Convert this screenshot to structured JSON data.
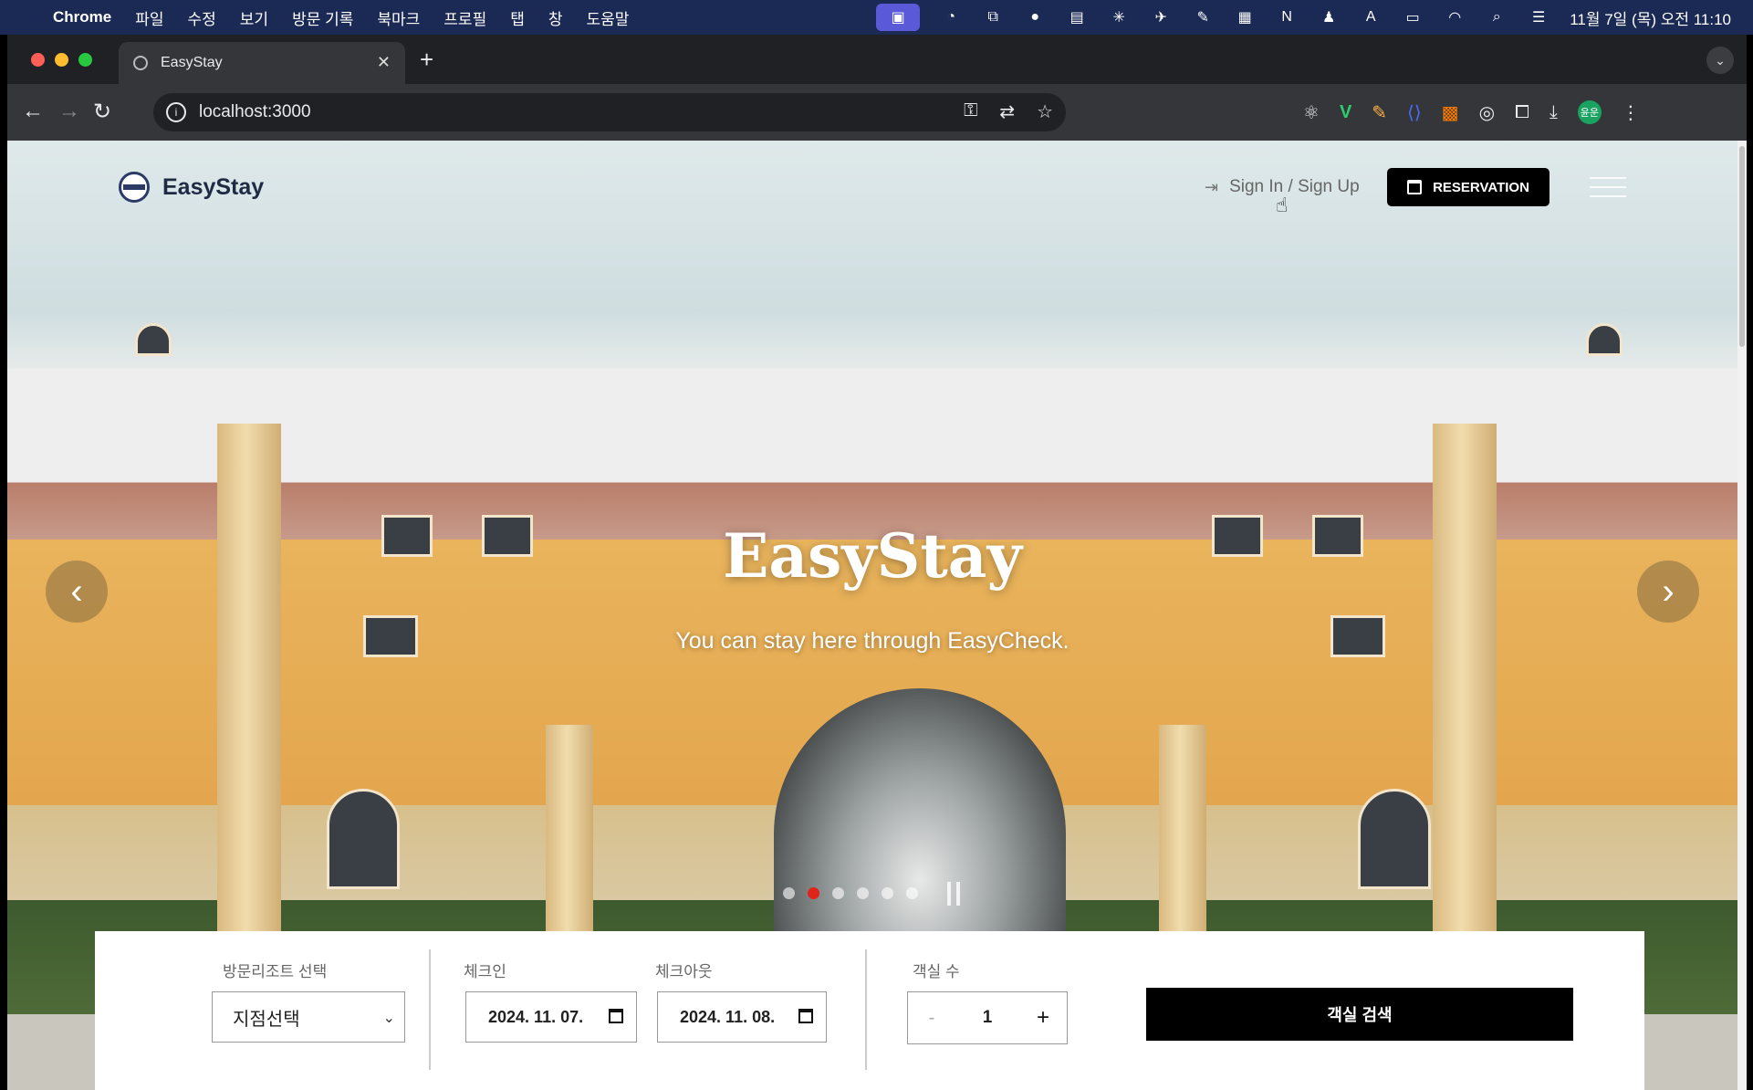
{
  "menubar": {
    "app": "Chrome",
    "items": [
      "파일",
      "수정",
      "보기",
      "방문 기록",
      "북마크",
      "프로필",
      "탭",
      "창",
      "도움말"
    ],
    "clock": "11월 7일 (목) 오전 11:10"
  },
  "browser": {
    "tab_title": "EasyStay",
    "url": "localhost:3000",
    "profile_initials": "윤운"
  },
  "site": {
    "logo_text": "EasyStay",
    "signin_label": "Sign In / Sign Up",
    "reservation_label": "RESERVATION"
  },
  "hero": {
    "title": "EasyStay",
    "subtitle": "You can stay here through EasyCheck.",
    "slide_count": 6,
    "active_slide": 2
  },
  "booking": {
    "resort_label": "방문리조트 선택",
    "resort_value": "지점선택",
    "checkin_label": "체크인",
    "checkin_value": "2024. 11. 07.",
    "checkout_label": "체크아웃",
    "checkout_value": "2024. 11. 08.",
    "rooms_label": "객실 수",
    "rooms_value": "1",
    "minus": "-",
    "plus": "+",
    "search_label": "객실 검색"
  },
  "colors": {
    "menubar": "#1b2a55",
    "active_dot": "#e0241c",
    "primary_button": "#000000"
  }
}
